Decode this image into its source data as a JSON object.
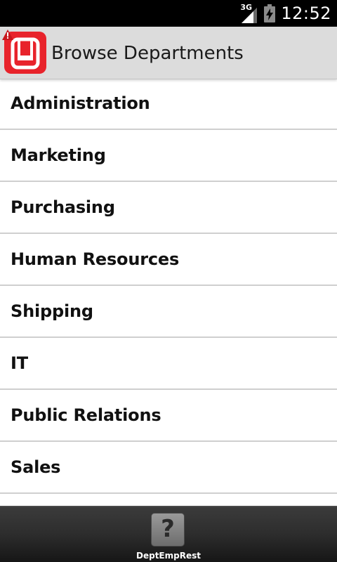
{
  "status_bar": {
    "network_type": "3G",
    "signal_icon": "signal-bars-icon",
    "battery_icon": "battery-charging-icon",
    "time": "12:52"
  },
  "title_bar": {
    "app_icon": "tablet-app-icon",
    "warning_icon": "warning-triangle-icon",
    "title": "Browse Departments",
    "app_icon_color": "#e8232b"
  },
  "departments": [
    {
      "label": "Administration"
    },
    {
      "label": "Marketing"
    },
    {
      "label": "Purchasing"
    },
    {
      "label": "Human Resources"
    },
    {
      "label": "Shipping"
    },
    {
      "label": "IT"
    },
    {
      "label": "Public Relations"
    },
    {
      "label": "Sales"
    }
  ],
  "bottom_bar": {
    "app_icon": "question-mark-icon",
    "app_icon_glyph": "?",
    "app_label": "DeptEmpRest"
  }
}
